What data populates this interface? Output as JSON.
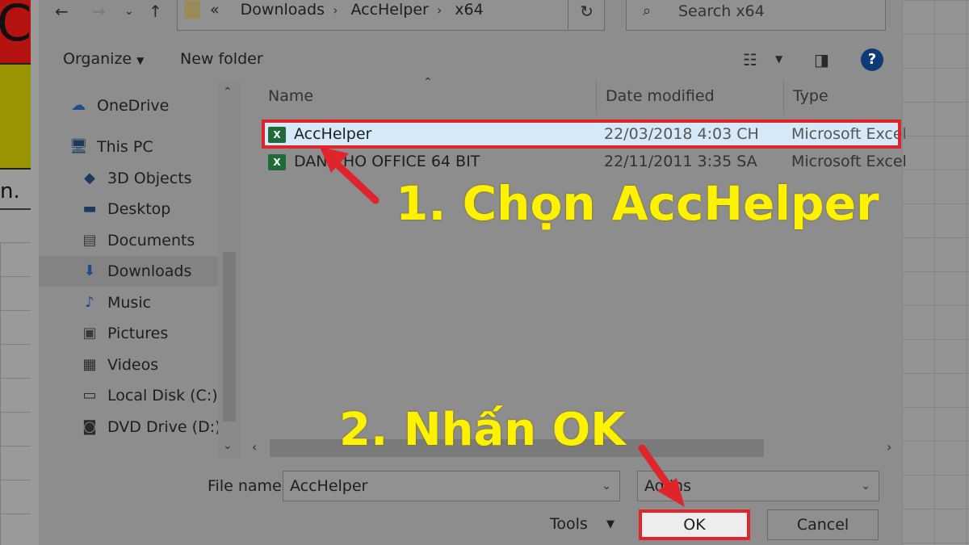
{
  "address_bar": {
    "overflow": "«",
    "crumbs": [
      "Downloads",
      "AccHelper",
      "x64"
    ],
    "search_placeholder": "Search x64"
  },
  "toolbar": {
    "organize": "Organize",
    "new_folder": "New folder",
    "help": "?"
  },
  "sidebar": {
    "items": [
      {
        "label": "OneDrive",
        "icon": "cloud-icon"
      },
      {
        "label": "This PC",
        "icon": "computer-icon"
      },
      {
        "label": "3D Objects",
        "icon": "cube-icon"
      },
      {
        "label": "Desktop",
        "icon": "desktop-icon"
      },
      {
        "label": "Documents",
        "icon": "document-icon"
      },
      {
        "label": "Downloads",
        "icon": "download-icon",
        "selected": true
      },
      {
        "label": "Music",
        "icon": "music-icon"
      },
      {
        "label": "Pictures",
        "icon": "picture-icon"
      },
      {
        "label": "Videos",
        "icon": "video-icon"
      },
      {
        "label": "Local Disk (C:)",
        "icon": "disk-icon"
      },
      {
        "label": "DVD Drive (D:) O",
        "icon": "dvd-icon"
      }
    ]
  },
  "filelist": {
    "columns": [
      "Name",
      "Date modified",
      "Type"
    ],
    "rows": [
      {
        "name": "AccHelper",
        "date": "22/03/2018 4:03 CH",
        "type": "Microsoft Excel",
        "selected": true
      },
      {
        "name": "DANH SACH CHO OFFICE 64 BIT",
        "name_visible": "DAN    CHO OFFICE 64 BIT",
        "date": "22/11/2011 3:35 SA",
        "type": "Microsoft Excel"
      }
    ]
  },
  "bottom": {
    "file_name_label": "File name:",
    "file_name_value": "AccHelper",
    "file_type_value": "Ad   ins",
    "tools": "Tools",
    "ok": "OK",
    "cancel": "Cancel"
  },
  "annotations": {
    "step1": "1. Chọn AccHelper",
    "step2": "2. Nhấn OK"
  },
  "colors": {
    "highlight_red": "#e0242b",
    "annotation_yellow": "#fff200",
    "help_blue": "#0d3b78"
  }
}
